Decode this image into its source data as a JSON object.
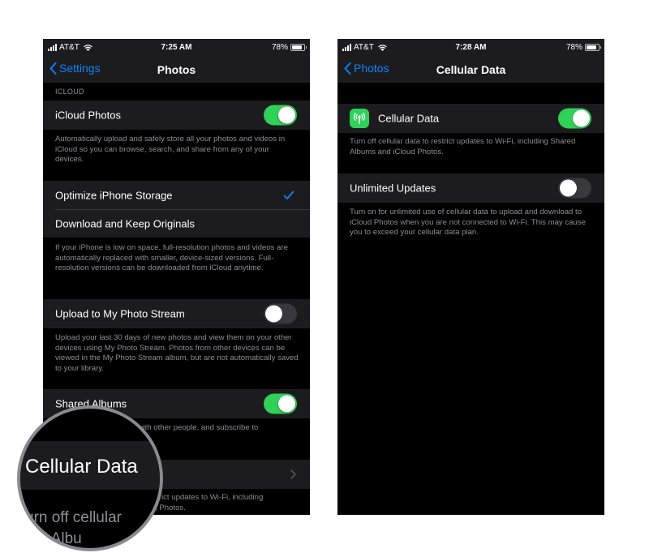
{
  "left": {
    "status": {
      "carrier": "AT&T",
      "time": "7:25 AM",
      "battery": "78%"
    },
    "nav": {
      "back": "Settings",
      "title": "Photos"
    },
    "icloud_header": "ICLOUD",
    "icloud_photos": {
      "label": "iCloud Photos",
      "on": true
    },
    "icloud_footer": "Automatically upload and safely store all your photos and videos in iCloud so you can browse, search, and share from any of your devices.",
    "optimize_label": "Optimize iPhone Storage",
    "download_label": "Download and Keep Originals",
    "storage_footer": "If your iPhone is low on space, full-resolution photos and videos are automatically replaced with smaller, device-sized versions. Full-resolution versions can be downloaded from iCloud anytime.",
    "photo_stream": {
      "label": "Upload to My Photo Stream",
      "on": false
    },
    "photo_stream_footer": "Upload your last 30 days of new photos and view them on your other devices using My Photo Stream. Photos from other devices can be viewed in the My Photo Stream album, but are not automatically saved to your library.",
    "shared_albums": {
      "label": "Shared Albums",
      "on": true
    },
    "shared_footer_line1": "are with other people, and subscribe to",
    "shared_footer_line2": "lbums.",
    "cellular_footer_line1": "estrict updates to Wi-Fi, including",
    "cellular_footer_line2": "ud Photos."
  },
  "magnifier": {
    "label": "Cellular Data",
    "footer_line1": "urn off cellular",
    "footer_line2": "red Albu"
  },
  "right": {
    "status": {
      "carrier": "AT&T",
      "time": "7:28 AM",
      "battery": "78%"
    },
    "nav": {
      "back": "Photos",
      "title": "Cellular Data"
    },
    "cellular_data": {
      "label": "Cellular Data",
      "on": true,
      "icon": "antenna-icon"
    },
    "cellular_footer": "Turn off cellular data to restrict updates to Wi-Fi, including Shared Albums and iCloud Photos.",
    "unlimited_updates": {
      "label": "Unlimited Updates",
      "on": false
    },
    "unlimited_footer": "Turn on for unlimited use of cellular data to upload and download to iCloud Photos when you are not connected to Wi-Fi. This may cause you to exceed your cellular data plan."
  },
  "colors": {
    "accent": "#0a84ff",
    "toggle_on": "#30d158",
    "cell_bg": "#1c1c1e",
    "footer_text": "#8e8e93"
  }
}
